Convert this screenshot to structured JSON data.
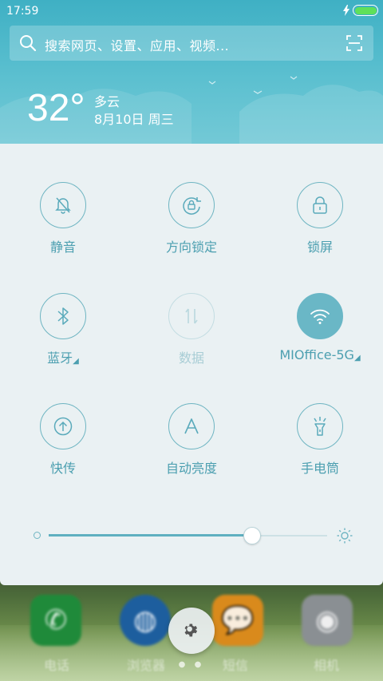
{
  "status_bar": {
    "time": "17:59"
  },
  "search": {
    "placeholder": "搜索网页、设置、应用、视频..."
  },
  "weather": {
    "temperature": "32°",
    "condition": "多云",
    "date": "8月10日 周三"
  },
  "toggles": [
    {
      "label": "静音",
      "icon": "bell-off-icon",
      "state": "off"
    },
    {
      "label": "方向锁定",
      "icon": "rotation-lock-icon",
      "state": "off"
    },
    {
      "label": "锁屏",
      "icon": "lock-icon",
      "state": "off"
    },
    {
      "label": "蓝牙",
      "icon": "bluetooth-icon",
      "state": "off",
      "expandable": true
    },
    {
      "label": "数据",
      "icon": "mobile-data-icon",
      "state": "disabled"
    },
    {
      "label": "MIOffice-5G",
      "icon": "wifi-icon",
      "state": "on",
      "expandable": true
    },
    {
      "label": "快传",
      "icon": "quick-transfer-icon",
      "state": "off"
    },
    {
      "label": "自动亮度",
      "icon": "auto-brightness-icon",
      "state": "off"
    },
    {
      "label": "手电筒",
      "icon": "flashlight-icon",
      "state": "off"
    }
  ],
  "brightness": {
    "level": 0.73
  },
  "dock": [
    {
      "label": "电话",
      "icon": "phone-icon",
      "color": "#1f8a3a"
    },
    {
      "label": "浏览器",
      "icon": "browser-icon",
      "color": "#1d5e9e"
    },
    {
      "label": "短信",
      "icon": "message-icon",
      "color": "#d98a1c"
    },
    {
      "label": "相机",
      "icon": "camera-icon",
      "color": "#8a8f93"
    }
  ],
  "colors": {
    "accent": "#5fb0c0",
    "header": "#4db8ca",
    "panel": "#eaf1f3"
  }
}
